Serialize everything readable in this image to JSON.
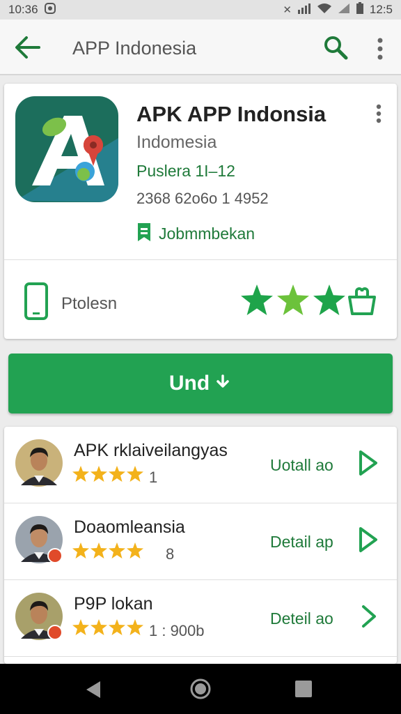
{
  "status_bar": {
    "time": "10:36",
    "battery": "12:5"
  },
  "app_bar": {
    "title": "APP Indonesia",
    "back_icon": "arrow-left-icon",
    "search_icon": "search-icon",
    "more_icon": "more-vert-icon"
  },
  "app": {
    "name": "APK APP Indonsia",
    "developer": "Indomesia",
    "category": "Puslera 1I–12",
    "meta": "2368 62o6o 1 4952",
    "badge_label": "Jobmmbekan",
    "platform_label": "Ptolesn",
    "rating_stars": 3
  },
  "install_button": {
    "label": "Und"
  },
  "list": {
    "link_label": "Detail ap",
    "items": [
      {
        "title": "APK rklaiveilangyas",
        "stars": 4,
        "count": "1",
        "link": "Uotall ao"
      },
      {
        "title": "Doaomleansia",
        "stars": 4,
        "count": "8",
        "link": "Detail ap"
      },
      {
        "title": "P9P lokan",
        "stars": 4,
        "count": "1 : 900b",
        "link": "Deteil ao"
      }
    ]
  },
  "colors": {
    "accent": "#22a252",
    "link": "#1f7a3a",
    "star_yellow": "#f3b21b",
    "star_green": "#1ea44a"
  }
}
